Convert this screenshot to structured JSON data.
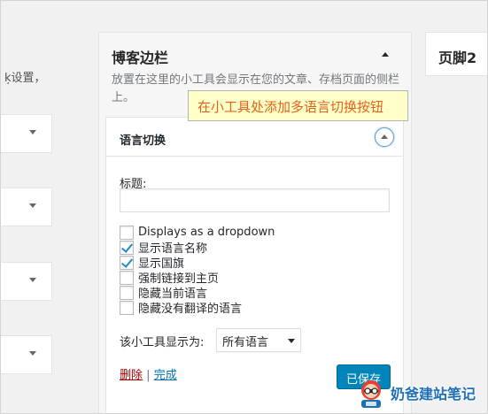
{
  "left_column": {
    "description_fragment": "ķ设置，"
  },
  "sidebar_panel": {
    "title": "博客边栏",
    "description": "放置在这里的小工具会显示在您的文章、存档页面的侧栏上。"
  },
  "callout": {
    "text": "在小工具处添加多语言切换按钮"
  },
  "widget": {
    "title": "语言切换",
    "title_field_label": "标题:",
    "title_field_value": "",
    "options": [
      {
        "label": "Displays as a dropdown",
        "checked": false
      },
      {
        "label": "显示语言名称",
        "checked": true
      },
      {
        "label": "显示国旗",
        "checked": true
      },
      {
        "label": "强制链接到主页",
        "checked": false
      },
      {
        "label": "隐藏当前语言",
        "checked": false
      },
      {
        "label": "隐藏没有翻译的语言",
        "checked": false
      }
    ],
    "display_label": "该小工具显示为:",
    "display_select_value": "所有语言",
    "delete_link": "删除",
    "separator": "|",
    "done_link": "完成",
    "save_button": "已保存"
  },
  "footer_panel": {
    "title": "页脚2"
  },
  "watermark": {
    "text": "奶爸建站笔记"
  },
  "colors": {
    "accent": "#0085ba",
    "link": "#0073aa",
    "delete": "#aa0000",
    "callout_bg": "#ffffc8",
    "callout_text": "#e0621c"
  }
}
